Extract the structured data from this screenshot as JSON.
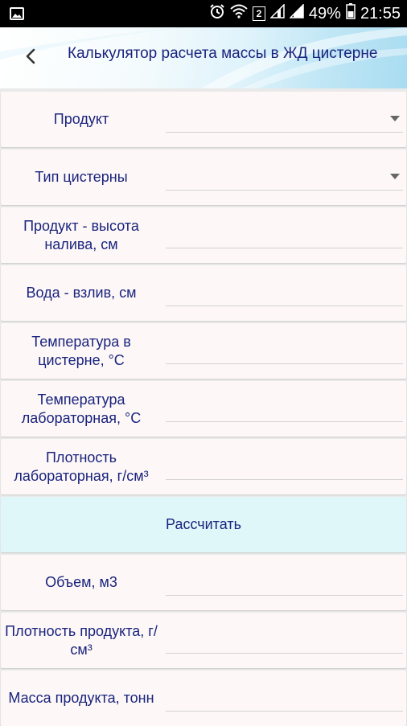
{
  "status_bar": {
    "battery": "49%",
    "time": "21:55",
    "sim_badge": "2",
    "icons": [
      "image-icon",
      "alarm-icon",
      "wifi-icon",
      "signal-icon",
      "signal-icon",
      "battery-icon"
    ]
  },
  "app_bar": {
    "title": "Калькулятор расчета массы в ЖД цистерне",
    "back_icon": "chevron-left-icon"
  },
  "form": {
    "product_label": "Продукт",
    "product_value": "",
    "tank_type_label": "Тип цистерны",
    "tank_type_value": "",
    "product_height_label": "Продукт - высота налива, см",
    "product_height_value": "",
    "water_level_label": "Вода - взлив, см",
    "water_level_value": "",
    "tank_temp_label": "Температура в цистерне, °С",
    "tank_temp_value": "",
    "lab_temp_label": "Температура лабораторная, °С",
    "lab_temp_value": "",
    "lab_density_label": "Плотность лабораторная, г/см³",
    "lab_density_value": ""
  },
  "calculate_button": "Рассчитать",
  "results": {
    "volume_label": "Объем, м3",
    "volume_value": "",
    "product_density_label": "Плотность продукта, г/см³",
    "product_density_value": "",
    "product_mass_label": "Масса продукта, тонн",
    "product_mass_value": ""
  },
  "colors": {
    "label_text": "#1a237e",
    "row_background": "#fdf8f7",
    "button_background": "#e0f7fa",
    "status_bar": "#000000"
  }
}
